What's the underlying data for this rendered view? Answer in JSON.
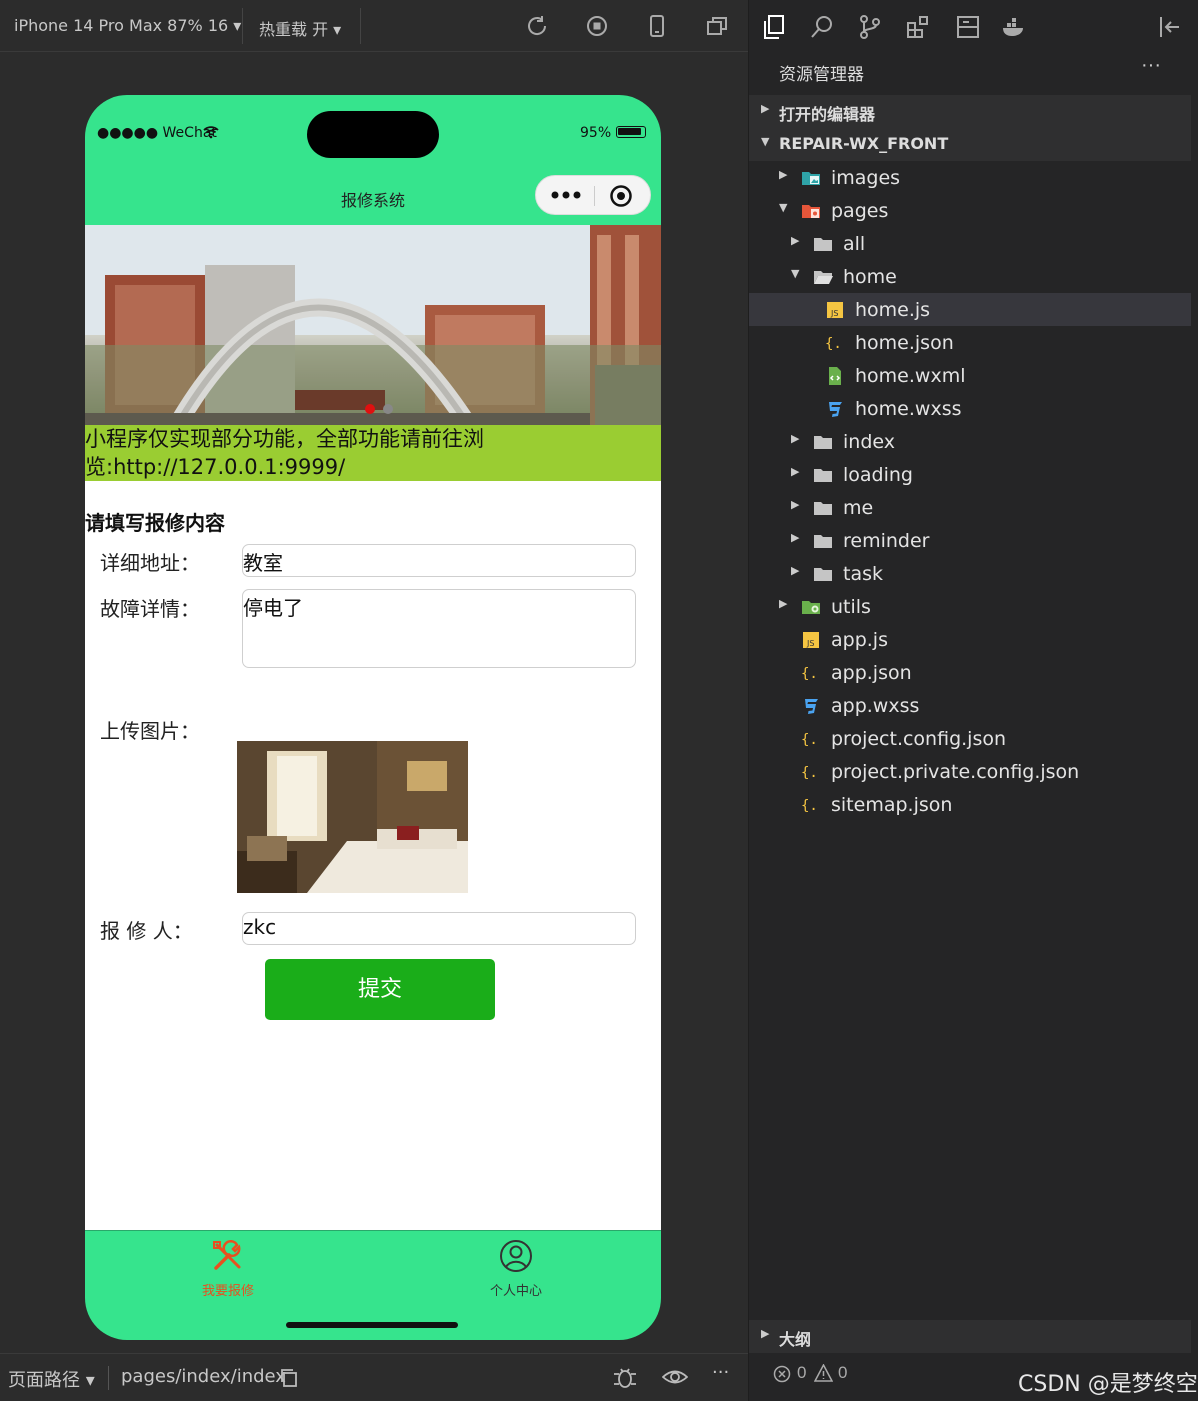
{
  "toolbar": {
    "device": "iPhone 14 Pro Max 87% 16 ▾",
    "hot_reload": "热重载 开 ▾"
  },
  "status_bar": {
    "carrier": "●●●●● WeChat",
    "battery": "95%"
  },
  "nav": {
    "title": "报修系统"
  },
  "banner": {
    "dot_count": 2,
    "active_dot": 0
  },
  "notice": {
    "line1": "小程序仅实现部分功能，全部功能请前往浏",
    "line2": "览:http://127.0.0.1:9999/"
  },
  "form": {
    "title": "请填写报修内容",
    "address_label": "详细地址：",
    "address_value": "教室",
    "detail_label": "故障详情：",
    "detail_value": "停电了",
    "upload_label": "上传图片：",
    "reporter_label": "报 修 人：",
    "reporter_value": "zkc",
    "submit_label": "提交"
  },
  "tabs": [
    {
      "label": "我要报修",
      "icon": "wrench-screwdriver-icon",
      "active": true,
      "color": "#e8501f"
    },
    {
      "label": "个人中心",
      "icon": "user-circle-icon",
      "active": false,
      "color": "#333333"
    }
  ],
  "bottom_bar": {
    "path_label": "页面路径 ▾",
    "path_value": "pages/index/index"
  },
  "explorer": {
    "title": "资源管理器",
    "more": "···",
    "open_editors": "打开的编辑器",
    "project": "REPAIR-WX_FRONT",
    "tree": [
      {
        "label": "images",
        "kind": "folder-images"
      },
      {
        "label": "pages",
        "kind": "folder-pages"
      },
      {
        "label": "all",
        "kind": "folder"
      },
      {
        "label": "home",
        "kind": "folder-open"
      },
      {
        "label": "home.js",
        "kind": "js"
      },
      {
        "label": "home.json",
        "kind": "json"
      },
      {
        "label": "home.wxml",
        "kind": "wxml"
      },
      {
        "label": "home.wxss",
        "kind": "wxss"
      },
      {
        "label": "index",
        "kind": "folder"
      },
      {
        "label": "loading",
        "kind": "folder"
      },
      {
        "label": "me",
        "kind": "folder"
      },
      {
        "label": "reminder",
        "kind": "folder"
      },
      {
        "label": "task",
        "kind": "folder"
      },
      {
        "label": "utils",
        "kind": "folder-utils"
      },
      {
        "label": "app.js",
        "kind": "js"
      },
      {
        "label": "app.json",
        "kind": "json"
      },
      {
        "label": "app.wxss",
        "kind": "wxss"
      },
      {
        "label": "project.config.json",
        "kind": "json"
      },
      {
        "label": "project.private.config.json",
        "kind": "json"
      },
      {
        "label": "sitemap.json",
        "kind": "json"
      }
    ],
    "outline": "大纲",
    "errors": "0",
    "warnings": "0"
  },
  "watermark": "CSDN @是梦终空",
  "colors": {
    "phone_bg": "#36e48d",
    "notice_bg": "#9acd32",
    "submit_bg": "#1aad19",
    "active_tab": "#e8501f"
  }
}
